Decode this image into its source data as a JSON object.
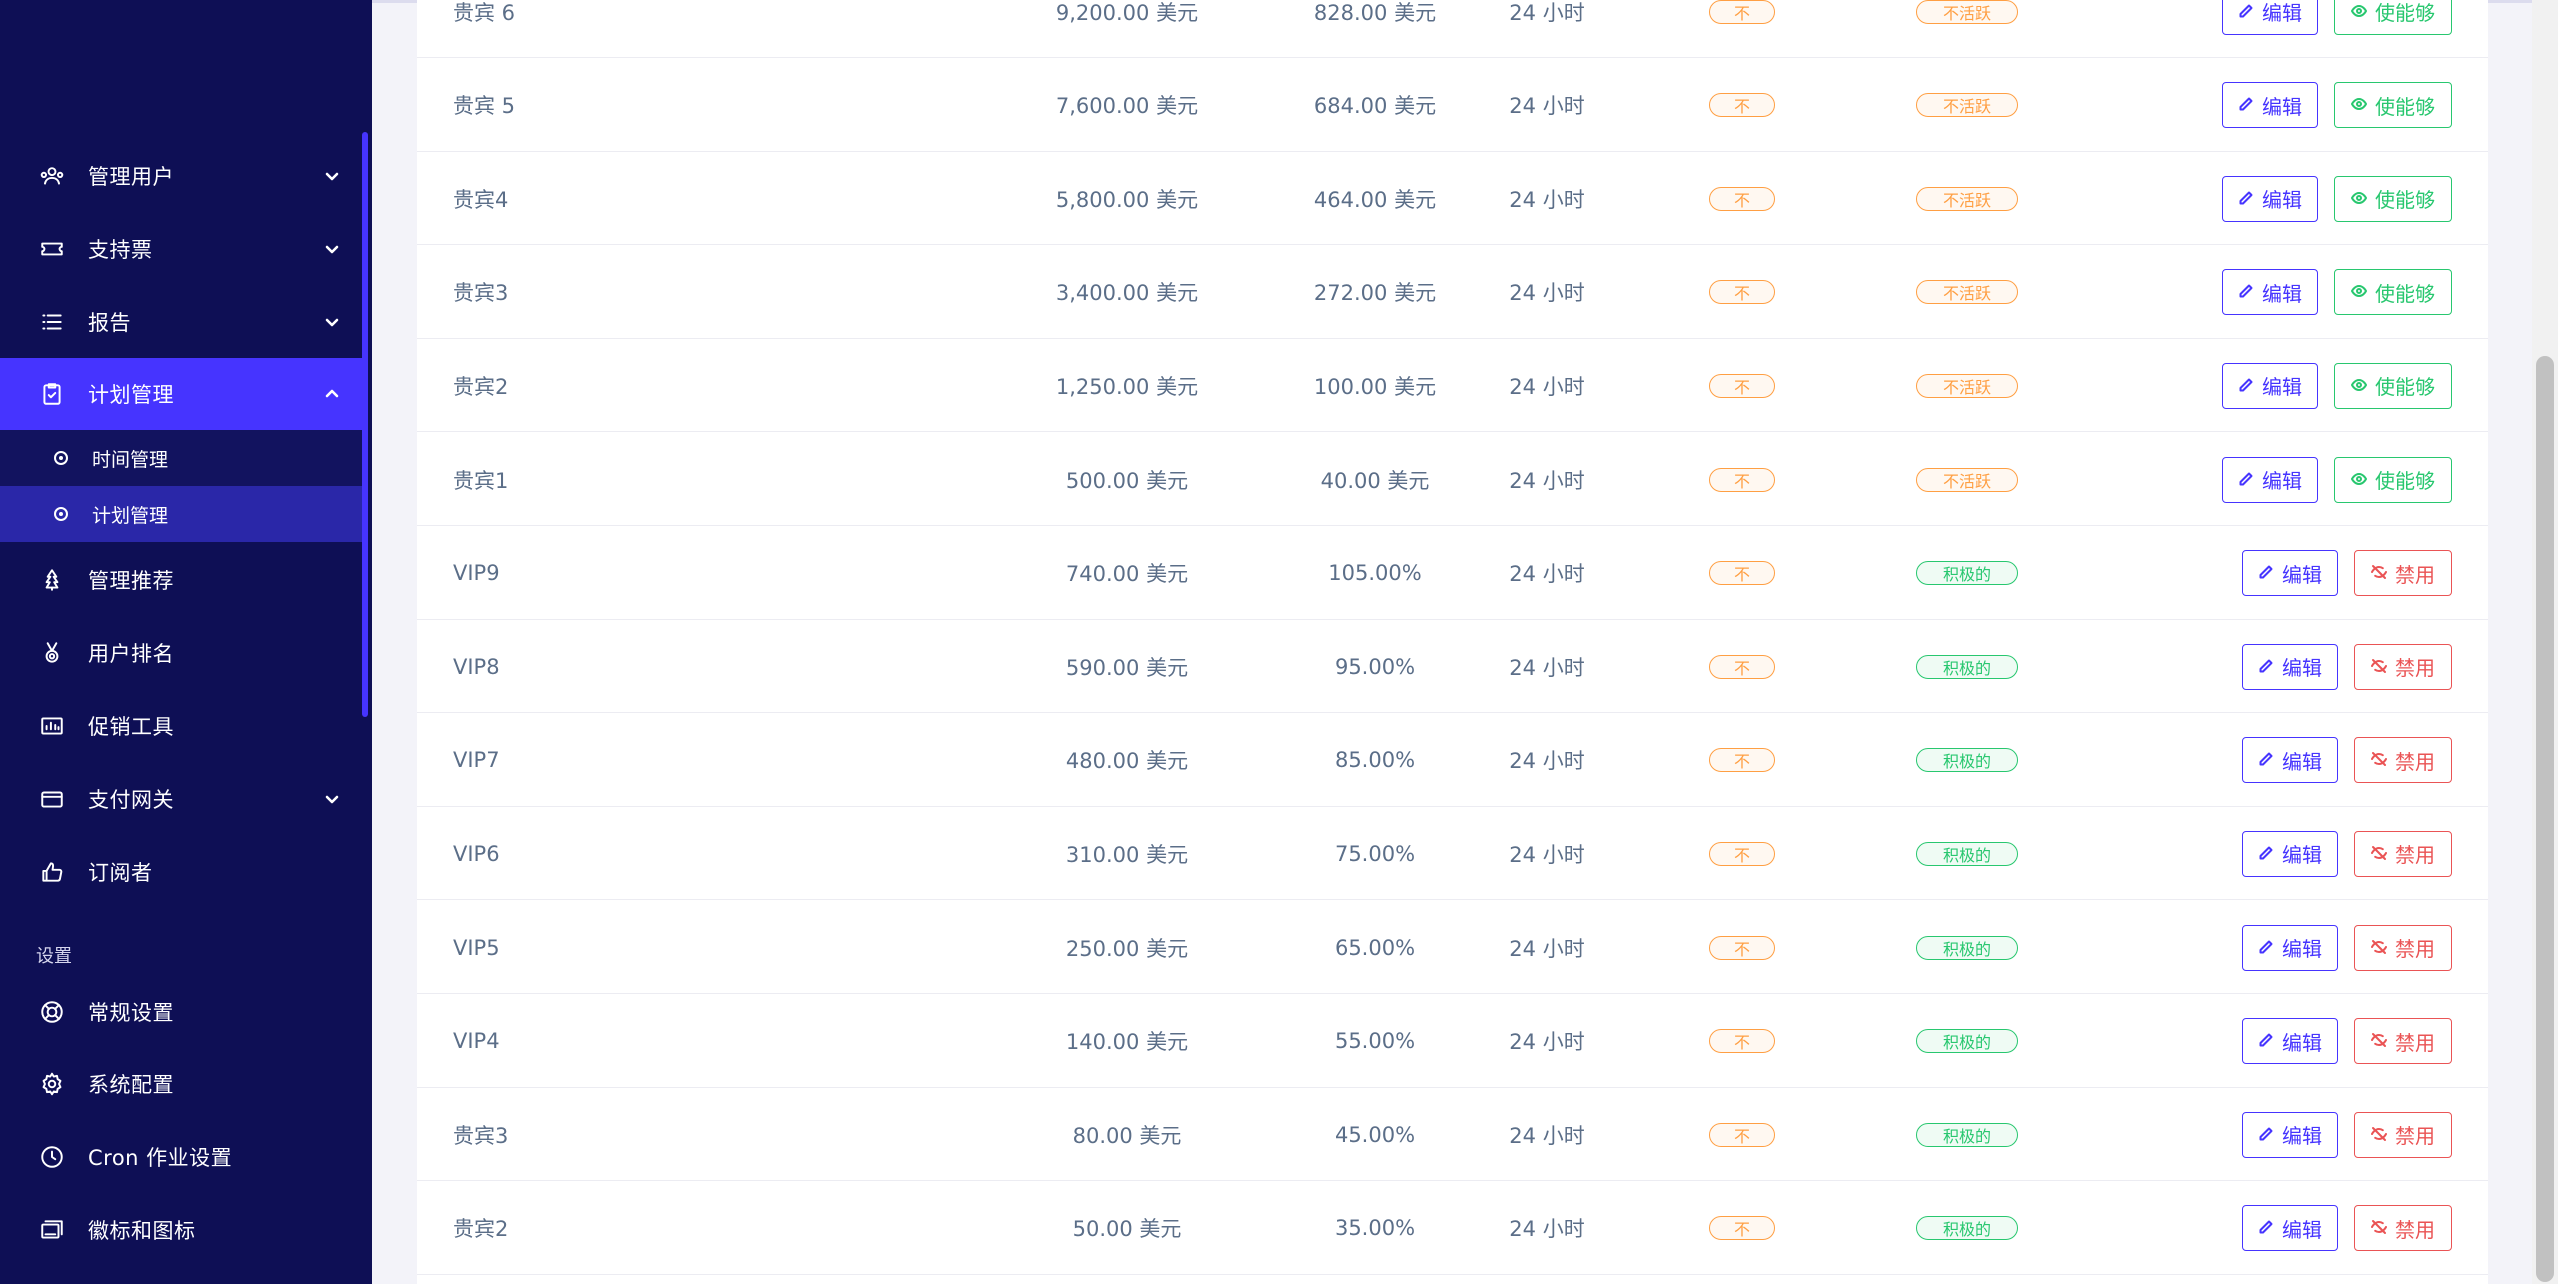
{
  "sidebar": {
    "items": [
      {
        "label": "管理用户",
        "icon": "users-gear-icon",
        "has_arrow": true,
        "arrow": "down",
        "active": false
      },
      {
        "label": "支持票",
        "icon": "ticket-icon",
        "has_arrow": true,
        "arrow": "down",
        "active": false
      },
      {
        "label": "报告",
        "icon": "list-icon",
        "has_arrow": true,
        "arrow": "down",
        "active": false
      },
      {
        "label": "计划管理",
        "icon": "clipboard-check-icon",
        "has_arrow": true,
        "arrow": "up",
        "active": true
      },
      {
        "label": "管理推荐",
        "icon": "tree-icon",
        "has_arrow": false,
        "active": false
      },
      {
        "label": "用户排名",
        "icon": "medal-icon",
        "has_arrow": false,
        "active": false
      },
      {
        "label": "促销工具",
        "icon": "chart-box-icon",
        "has_arrow": false,
        "active": false
      },
      {
        "label": "支付网关",
        "icon": "credit-card-icon",
        "has_arrow": true,
        "arrow": "down",
        "active": false
      },
      {
        "label": "订阅者",
        "icon": "thumbs-up-icon",
        "has_arrow": false,
        "active": false
      }
    ],
    "submenu": [
      {
        "label": "时间管理",
        "active": false
      },
      {
        "label": "计划管理",
        "active": true
      }
    ],
    "settings_title": "设置",
    "settings_items": [
      {
        "label": "常规设置",
        "icon": "lifebuoy-icon"
      },
      {
        "label": "系统配置",
        "icon": "gear-icon"
      },
      {
        "label": "Cron 作业设置",
        "icon": "clock-icon"
      },
      {
        "label": "徽标和图标",
        "icon": "images-icon"
      }
    ]
  },
  "table": {
    "rows": [
      {
        "name": "贵宾 6",
        "price": "9,200.00 美元",
        "bonus": "828.00 美元",
        "time": "24 小时",
        "flag": "不",
        "status": "不活跃",
        "status_type": "inactive",
        "edit_label": "编辑",
        "toggle_label": "使能够",
        "toggle_type": "enable"
      },
      {
        "name": "贵宾 5",
        "price": "7,600.00 美元",
        "bonus": "684.00 美元",
        "time": "24 小时",
        "flag": "不",
        "status": "不活跃",
        "status_type": "inactive",
        "edit_label": "编辑",
        "toggle_label": "使能够",
        "toggle_type": "enable"
      },
      {
        "name": "贵宾4",
        "price": "5,800.00 美元",
        "bonus": "464.00 美元",
        "time": "24 小时",
        "flag": "不",
        "status": "不活跃",
        "status_type": "inactive",
        "edit_label": "编辑",
        "toggle_label": "使能够",
        "toggle_type": "enable"
      },
      {
        "name": "贵宾3",
        "price": "3,400.00 美元",
        "bonus": "272.00 美元",
        "time": "24 小时",
        "flag": "不",
        "status": "不活跃",
        "status_type": "inactive",
        "edit_label": "编辑",
        "toggle_label": "使能够",
        "toggle_type": "enable"
      },
      {
        "name": "贵宾2",
        "price": "1,250.00 美元",
        "bonus": "100.00 美元",
        "time": "24 小时",
        "flag": "不",
        "status": "不活跃",
        "status_type": "inactive",
        "edit_label": "编辑",
        "toggle_label": "使能够",
        "toggle_type": "enable"
      },
      {
        "name": "贵宾1",
        "price": "500.00 美元",
        "bonus": "40.00 美元",
        "time": "24 小时",
        "flag": "不",
        "status": "不活跃",
        "status_type": "inactive",
        "edit_label": "编辑",
        "toggle_label": "使能够",
        "toggle_type": "enable"
      },
      {
        "name": "VIP9",
        "price": "740.00 美元",
        "bonus": "105.00%",
        "time": "24 小时",
        "flag": "不",
        "status": "积极的",
        "status_type": "active",
        "edit_label": "编辑",
        "toggle_label": "禁用",
        "toggle_type": "disable"
      },
      {
        "name": "VIP8",
        "price": "590.00 美元",
        "bonus": "95.00%",
        "time": "24 小时",
        "flag": "不",
        "status": "积极的",
        "status_type": "active",
        "edit_label": "编辑",
        "toggle_label": "禁用",
        "toggle_type": "disable"
      },
      {
        "name": "VIP7",
        "price": "480.00 美元",
        "bonus": "85.00%",
        "time": "24 小时",
        "flag": "不",
        "status": "积极的",
        "status_type": "active",
        "edit_label": "编辑",
        "toggle_label": "禁用",
        "toggle_type": "disable"
      },
      {
        "name": "VIP6",
        "price": "310.00 美元",
        "bonus": "75.00%",
        "time": "24 小时",
        "flag": "不",
        "status": "积极的",
        "status_type": "active",
        "edit_label": "编辑",
        "toggle_label": "禁用",
        "toggle_type": "disable"
      },
      {
        "name": "VIP5",
        "price": "250.00 美元",
        "bonus": "65.00%",
        "time": "24 小时",
        "flag": "不",
        "status": "积极的",
        "status_type": "active",
        "edit_label": "编辑",
        "toggle_label": "禁用",
        "toggle_type": "disable"
      },
      {
        "name": "VIP4",
        "price": "140.00 美元",
        "bonus": "55.00%",
        "time": "24 小时",
        "flag": "不",
        "status": "积极的",
        "status_type": "active",
        "edit_label": "编辑",
        "toggle_label": "禁用",
        "toggle_type": "disable"
      },
      {
        "name": "贵宾3",
        "price": "80.00 美元",
        "bonus": "45.00%",
        "time": "24 小时",
        "flag": "不",
        "status": "积极的",
        "status_type": "active",
        "edit_label": "编辑",
        "toggle_label": "禁用",
        "toggle_type": "disable"
      },
      {
        "name": "贵宾2",
        "price": "50.00 美元",
        "bonus": "35.00%",
        "time": "24 小时",
        "flag": "不",
        "status": "积极的",
        "status_type": "active",
        "edit_label": "编辑",
        "toggle_label": "禁用",
        "toggle_type": "disable"
      }
    ]
  },
  "colors": {
    "sidebar_bg": "#0e0f55",
    "accent": "#4634ff",
    "success": "#28c76f",
    "warning": "#ff9f43",
    "danger": "#ea5455"
  }
}
